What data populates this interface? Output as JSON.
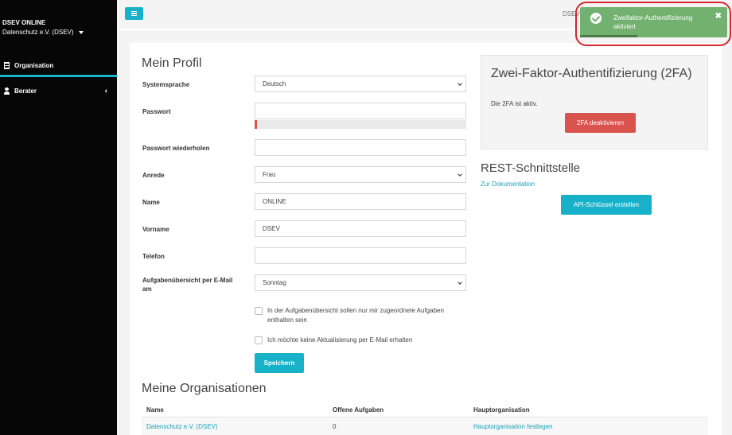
{
  "sidebar": {
    "brand": "DSEV ONLINE",
    "org": "Datenschutz e.V. (DSEV)",
    "items": [
      {
        "label": "Organisation"
      },
      {
        "label": "Berater"
      }
    ]
  },
  "topbar": {
    "user": "DSEV"
  },
  "toast": {
    "message": "Zweifaktor-Authentifizierung aktiviert",
    "close": "✖"
  },
  "profile": {
    "title": "Mein Profil",
    "language_label": "Systemsprache",
    "language_value": "Deutsch",
    "password_label": "Passwort",
    "password_repeat_label": "Passwort wiederholen",
    "salutation_label": "Anrede",
    "salutation_value": "Frau",
    "name_label": "Name",
    "name_value": "ONLINE",
    "firstname_label": "Vorname",
    "firstname_value": "DSEV",
    "phone_label": "Telefon",
    "digest_label": "Aufgabenübersicht per E-Mail am",
    "digest_value": "Sonntag",
    "check_assigned": "In der Aufgabenübersicht sollen nur mir zugeordnete Aufgaben enthalten sein",
    "check_no_updates": "Ich möchte keine Aktualisierung per E-Mail erhalten",
    "save": "Speichern"
  },
  "tfa": {
    "title": "Zwei-Faktor-Authentifizierung (2FA)",
    "status": "Die 2FA ist aktiv.",
    "deactivate": "2FA deaktivieren"
  },
  "rest": {
    "title": "REST-Schnittstelle",
    "doc_link": "Zur Dokumentation",
    "create_key": "API-Schlüssel erstellen"
  },
  "orgs": {
    "title": "Meine Organisationen",
    "columns": [
      "Name",
      "Offene Aufgaben",
      "Hauptorganisation"
    ],
    "rows": [
      {
        "name": "Datenschutz e.V. (DSEV)",
        "open": "0",
        "main": "Hauptorganisation festlegen"
      }
    ]
  }
}
